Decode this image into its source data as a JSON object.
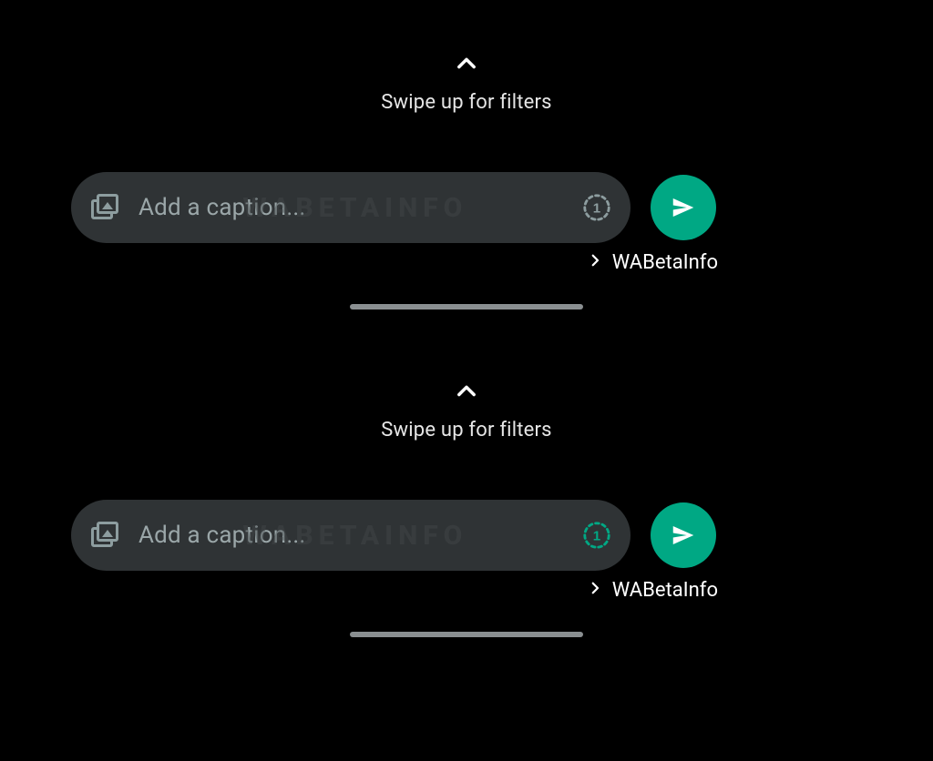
{
  "panels": [
    {
      "swipe_hint": "Swipe up for filters",
      "caption_placeholder": "Add a caption...",
      "watermark": "WABETAINFO",
      "view_once_digit": "1",
      "view_once_state": "inactive",
      "recipient": "WABetaInfo"
    },
    {
      "swipe_hint": "Swipe up for filters",
      "caption_placeholder": "Add a caption...",
      "watermark": "WABETAINFO",
      "view_once_digit": "1",
      "view_once_state": "active",
      "recipient": "WABetaInfo"
    }
  ],
  "colors": {
    "accent": "#00a884"
  }
}
